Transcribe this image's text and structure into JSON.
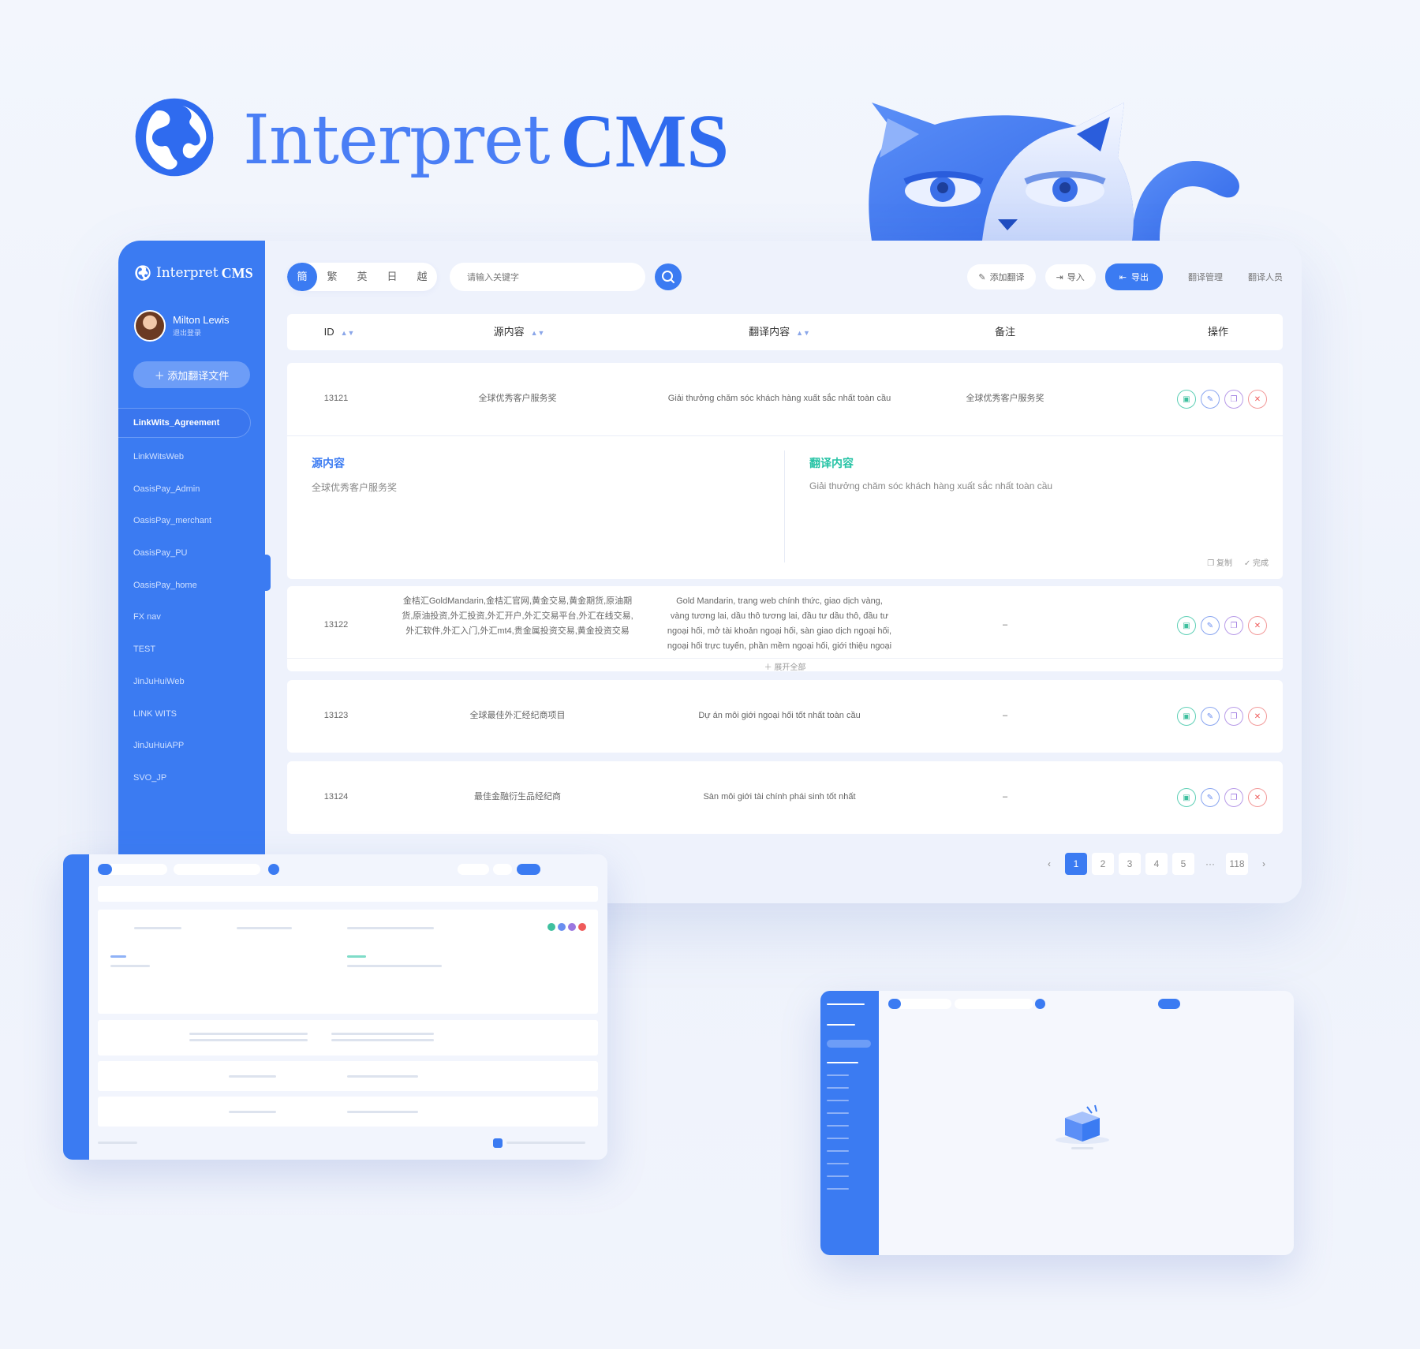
{
  "brand": {
    "name_light": "Interpret",
    "name_bold": "CMS"
  },
  "colors": {
    "primary": "#3b7bf2",
    "green": "#3fc09f",
    "blue": "#6a8ef0",
    "purple": "#9b77e0",
    "red": "#ef5a5a",
    "teal": "#25c3a5"
  },
  "sidebar": {
    "user_name": "Milton Lewis",
    "user_sub": "退出登录",
    "add_button": "＋ 添加翻译文件",
    "items": [
      {
        "label": "LinkWits_Agreement",
        "active": true
      },
      {
        "label": "LinkWitsWeb"
      },
      {
        "label": "OasisPay_Admin"
      },
      {
        "label": "OasisPay_merchant"
      },
      {
        "label": "OasisPay_PU"
      },
      {
        "label": "OasisPay_home"
      },
      {
        "label": "FX nav"
      },
      {
        "label": "TEST"
      },
      {
        "label": "JinJuHuiWeb"
      },
      {
        "label": "LINK WITS"
      },
      {
        "label": "JinJuHuiAPP"
      },
      {
        "label": "SVO_JP"
      }
    ]
  },
  "toolbar": {
    "langs": [
      "簡",
      "繁",
      "英",
      "日",
      "越"
    ],
    "search_placeholder": "请输入关键字",
    "add_translation": "添加翻译",
    "import": "导入",
    "export": "导出",
    "translation_mgmt": "翻译管理",
    "translators": "翻译人员"
  },
  "table": {
    "headers": {
      "id": "ID",
      "source": "源内容",
      "translation": "翻译内容",
      "note": "备注",
      "actions": "操作"
    },
    "rows": [
      {
        "id": "13121",
        "source": "全球优秀客户服务奖",
        "translation": "Giải thưởng chăm sóc khách hàng xuất sắc nhất toàn cầu",
        "note": "全球优秀客户服务奖"
      },
      {
        "id": "13122",
        "source_lines": [
          "金桔汇GoldMandarin,金桔汇官网,黄金交易,黄金期货,原油期",
          "货,原油投资,外汇投资,外汇开户,外汇交易平台,外汇在线交易,",
          "外汇软件,外汇入门,外汇mt4,贵金属投资交易,黄金投资交易"
        ],
        "translation_lines": [
          "Gold Mandarin, trang web chính thức, giao dịch vàng,",
          "vàng tương lai, dầu thô tương lai, đầu tư dầu thô, đầu tư",
          "ngoại hối, mở tài khoản ngoại hối, sàn giao dịch ngoại hối,",
          "ngoại hối trực tuyến, phần mềm ngoại hối, giới thiệu ngoại"
        ],
        "note": "–",
        "expand_all": "＋ 展开全部"
      },
      {
        "id": "13123",
        "source": "全球最佳外汇经纪商项目",
        "translation": "Dự án môi giới ngoại hối tốt nhất toàn cầu",
        "note": "–"
      },
      {
        "id": "13124",
        "source": "最佳金融衍生品经纪商",
        "translation": "Sàn môi giới tài chính phái sinh tốt nhất",
        "note": "–"
      }
    ]
  },
  "expanded": {
    "source_label": "源内容",
    "source_text": "全球优秀客户服务奖",
    "translation_label": "翻译内容",
    "translation_text": "Giải thưởng chăm sóc khách hàng xuất sắc nhất toàn cầu",
    "copy": "复制",
    "done": "完成"
  },
  "pagination": {
    "pages": [
      "1",
      "2",
      "3",
      "4",
      "5"
    ],
    "ellipsis": "···",
    "last": "118",
    "current": "1"
  }
}
